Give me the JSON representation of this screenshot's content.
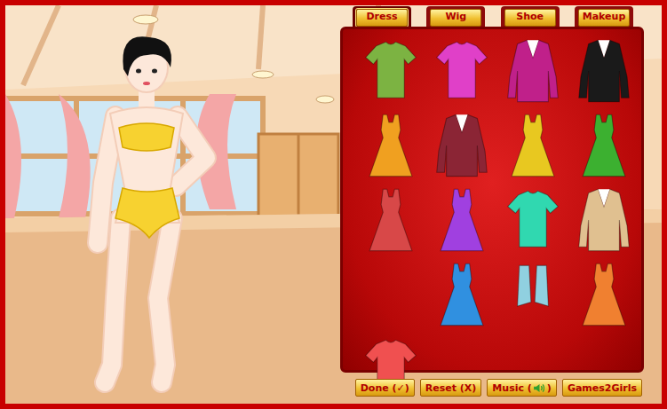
{
  "tabs": [
    {
      "label": "Dress",
      "selected": true
    },
    {
      "label": "Wig",
      "selected": false
    },
    {
      "label": "Shoe",
      "selected": false
    },
    {
      "label": "Makeup",
      "selected": false
    }
  ],
  "items": [
    {
      "kind": "top",
      "color": "#7cb342"
    },
    {
      "kind": "top",
      "color": "#e040c8"
    },
    {
      "kind": "jacket",
      "color": "#c0208a"
    },
    {
      "kind": "jacket",
      "color": "#1a1a1a"
    },
    {
      "kind": "dress",
      "color": "#f0a020"
    },
    {
      "kind": "jacket",
      "color": "#8b2535"
    },
    {
      "kind": "dress",
      "color": "#e8c820"
    },
    {
      "kind": "dress",
      "color": "#3cb030"
    },
    {
      "kind": "dress",
      "color": "#d84848"
    },
    {
      "kind": "dress",
      "color": "#a040e0"
    },
    {
      "kind": "top",
      "color": "#30d8b0"
    },
    {
      "kind": "jacket",
      "color": "#e0c090"
    },
    {
      "kind": "dress",
      "color": "#3090e0"
    },
    {
      "kind": "vest",
      "color": "#90d0e0"
    },
    {
      "kind": "dress",
      "color": "#f08030"
    },
    {
      "kind": "top",
      "color": "#f05050"
    }
  ],
  "buttons": [
    {
      "label": "Done (✓)",
      "kind": "text"
    },
    {
      "label": "Reset (X)",
      "kind": "text"
    },
    {
      "label": "Music (",
      "suffix": ")",
      "kind": "sound",
      "on": true
    },
    {
      "label": "Games2Girls",
      "kind": "text"
    }
  ]
}
